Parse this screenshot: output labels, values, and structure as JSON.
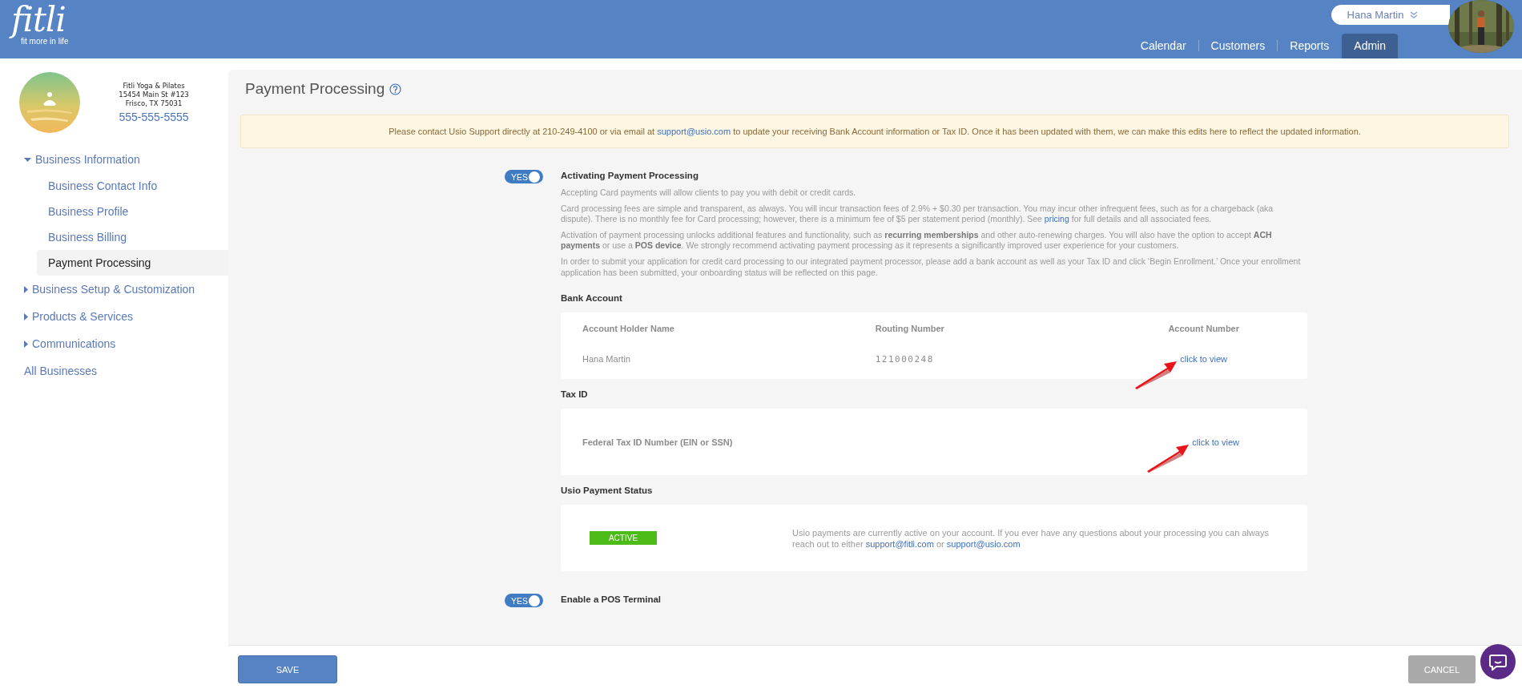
{
  "header": {
    "logo": {
      "wordmark": "fitli",
      "tagline": "fit more in life"
    },
    "user": {
      "name": "Hana Martin"
    },
    "tabs": [
      {
        "label": "Calendar",
        "selected": false
      },
      {
        "label": "Customers",
        "selected": false
      },
      {
        "label": "Reports",
        "selected": false
      },
      {
        "label": "Admin",
        "selected": true
      }
    ]
  },
  "sidebar": {
    "business": {
      "name": "Fitli Yoga & Pilates",
      "address": "15454 Main St #123",
      "city": "Frisco, TX 75031",
      "phone": "555-555-5555"
    },
    "nav": [
      {
        "kind": "group",
        "label": "Business Information",
        "expanded": true,
        "children": [
          {
            "label": "Business Contact Info",
            "selected": false
          },
          {
            "label": "Business Profile",
            "selected": false
          },
          {
            "label": "Business Billing",
            "selected": false
          },
          {
            "label": "Payment Processing",
            "selected": true
          }
        ]
      },
      {
        "kind": "group",
        "label": "Business Setup & Customization",
        "expanded": false
      },
      {
        "kind": "group",
        "label": "Products & Services",
        "expanded": false
      },
      {
        "kind": "group",
        "label": "Communications",
        "expanded": false
      },
      {
        "kind": "link",
        "label": "All Businesses"
      }
    ]
  },
  "page": {
    "title": "Payment Processing",
    "notice": [
      {
        "text": "Please contact Usio Support directly at 210-249-4100 or via email at "
      },
      {
        "link": "support@usio.com"
      },
      {
        "text": " to update your receiving Bank Account information or Tax ID. Once it has been updated with them, we can make this edits here to reflect the updated information."
      }
    ],
    "sections": [
      {
        "kind": "toggle",
        "toggle": {
          "on": true,
          "label": "YES"
        },
        "title": "Activating Payment Processing",
        "paragraphs": [
          [
            {
              "text": "Accepting Card payments will allow clients to pay you with debit or credit cards."
            }
          ],
          [
            {
              "text": "Card processing fees are simple and transparent, as always. You will incur transaction fees of 2.9% + $0.30 per transaction. You may incur other infrequent fees, such as for a chargeback (aka dispute). There is no monthly fee for Card processing; however, there is a minimum fee of $5 per statement period (monthly). See "
            },
            {
              "link": "pricing"
            },
            {
              "text": " for full details and all associated fees."
            }
          ],
          [
            {
              "text": "Activation of payment processing unlocks additional features and functionality, such as **recurring memberships** and other auto-renewing charges. You will also have the option to accept **ACH payments** or use a **POS device**. We strongly recommend activating payment processing as it represents a significantly improved user experience for your customers."
            }
          ],
          [
            {
              "text": "In order to submit your application for credit card processing to our integrated payment processor, please add a bank account as well as your Tax ID and click ‘Begin Enrollment.’ Once your enrollment application has been submitted, your onboarding status will be reflected on this page."
            }
          ]
        ]
      },
      {
        "kind": "heading",
        "title": "Bank Account"
      },
      {
        "kind": "bank-card",
        "columns": [
          "Account Holder Name",
          "Routing Number",
          "Account Number"
        ],
        "cells": [
          {
            "kind": "text",
            "text": "Hana Martin"
          },
          {
            "kind": "number",
            "text": "121000248"
          },
          {
            "kind": "link",
            "text": "click to view",
            "pointer_arrow": true
          }
        ]
      },
      {
        "kind": "heading",
        "title": "Tax ID"
      },
      {
        "kind": "field-card",
        "label": "Federal Tax ID Number (EIN or SSN)",
        "value": {
          "kind": "link",
          "text": "click to view",
          "pointer_arrow": true
        }
      },
      {
        "kind": "heading",
        "title": "Usio Payment Status"
      },
      {
        "kind": "status-card",
        "status": {
          "label": "ACTIVE",
          "color": "#4cbb17"
        },
        "message": [
          {
            "text": "Usio payments are currently active on your account. If you ever have any questions about your processing you can always reach out to either "
          },
          {
            "link": "support@fitli.com"
          },
          {
            "text": " or "
          },
          {
            "link": "support@usio.com"
          }
        ]
      },
      {
        "kind": "toggle",
        "toggle": {
          "on": true,
          "label": "YES"
        },
        "title": "Enable a POS Terminal"
      }
    ]
  },
  "footer": {
    "buttons": [
      {
        "label": "SAVE",
        "kind": "primary"
      },
      {
        "label": "CANCEL",
        "kind": "secondary"
      }
    ]
  }
}
